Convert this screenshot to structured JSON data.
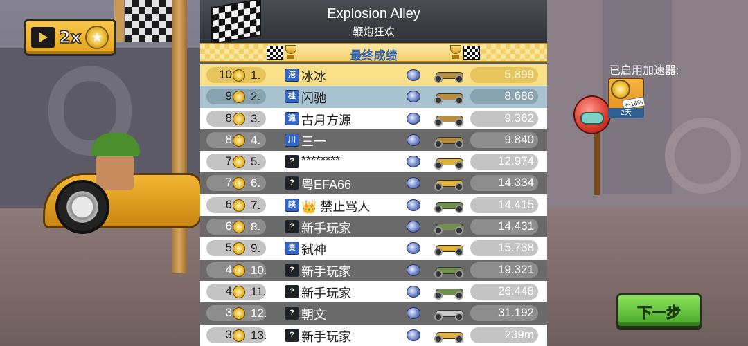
{
  "track": {
    "title": "Explosion Alley",
    "subtitle": "鞭炮狂欢"
  },
  "boost_badge": {
    "label": "2x"
  },
  "results_title": "最终成绩",
  "rows": [
    {
      "coins": "10",
      "rank": "1.",
      "flag": "港",
      "flag_type": "region",
      "name": "冰冰",
      "vehicle_color": "#b78d3c",
      "time": "5.899",
      "style": "first"
    },
    {
      "coins": "9",
      "rank": "2.",
      "flag": "桂",
      "flag_type": "region",
      "name": "闪驰",
      "vehicle_color": "#b78d3c",
      "time": "8.686",
      "style": "second"
    },
    {
      "coins": "8",
      "rank": "3.",
      "flag": "滬",
      "flag_type": "region",
      "name": "古月方源",
      "vehicle_color": "#b78d3c",
      "time": "9.362",
      "style": "odd"
    },
    {
      "coins": "8",
      "rank": "4.",
      "flag": "川",
      "flag_type": "region",
      "name": "三一",
      "vehicle_color": "#b78d3c",
      "time": "9.840",
      "style": "even"
    },
    {
      "coins": "7",
      "rank": "5.",
      "flag": "?",
      "flag_type": "unknown",
      "name": "********",
      "vehicle_color": "#e0b23a",
      "time": "12.974",
      "style": "odd"
    },
    {
      "coins": "7",
      "rank": "6.",
      "flag": "?",
      "flag_type": "unknown",
      "name": "粤EFA66",
      "vehicle_color": "#e0b23a",
      "time": "14.334",
      "style": "even"
    },
    {
      "coins": "6",
      "rank": "7.",
      "flag": "陕",
      "flag_type": "region",
      "name": "👑 禁止骂人",
      "vehicle_color": "#6f8f4a",
      "time": "14.415",
      "style": "odd"
    },
    {
      "coins": "6",
      "rank": "8.",
      "flag": "?",
      "flag_type": "unknown",
      "name": "新手玩家",
      "vehicle_color": "#6f8f4a",
      "time": "14.431",
      "style": "even"
    },
    {
      "coins": "5",
      "rank": "9.",
      "flag": "贵",
      "flag_type": "region",
      "name": "弑神",
      "vehicle_color": "#e0b23a",
      "time": "15.738",
      "style": "odd"
    },
    {
      "coins": "4",
      "rank": "10.",
      "flag": "?",
      "flag_type": "unknown",
      "name": "新手玩家",
      "vehicle_color": "#6f8f4a",
      "time": "19.321",
      "style": "even"
    },
    {
      "coins": "4",
      "rank": "11.",
      "flag": "?",
      "flag_type": "unknown",
      "name": "新手玩家",
      "vehicle_color": "#6f8f4a",
      "time": "26.448",
      "style": "odd"
    },
    {
      "coins": "3",
      "rank": "12.",
      "flag": "?",
      "flag_type": "unknown",
      "name": "朝文",
      "vehicle_color": "#c9c9c9",
      "time": "31.192",
      "style": "even"
    },
    {
      "coins": "3",
      "rank": "13.",
      "flag": "?",
      "flag_type": "unknown",
      "name": "新手玩家",
      "vehicle_color": "#e0b23a",
      "time": "239m",
      "style": "odd"
    }
  ],
  "boosters": {
    "label": "已启用加速器:",
    "tag": "+-16%",
    "days": "2天"
  },
  "next_button": {
    "label": "下一步"
  },
  "colors": {
    "gold_row": "#fbe08a",
    "silver_row": "#a9c2cf",
    "next_green": "#5ec13a"
  }
}
